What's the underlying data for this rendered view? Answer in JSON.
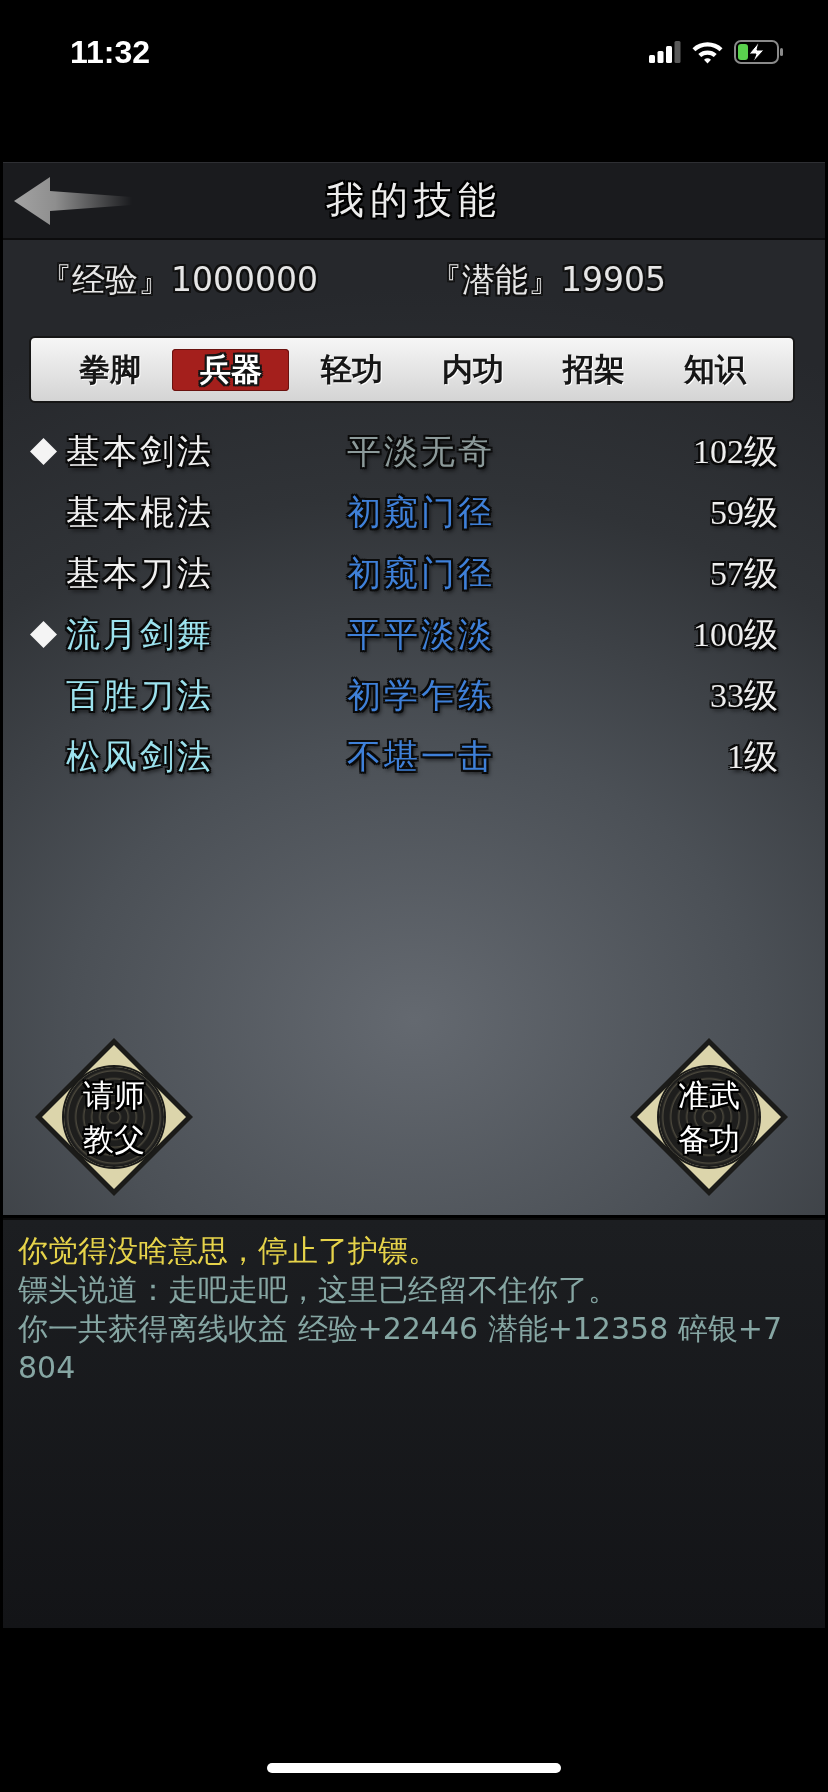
{
  "status_bar": {
    "time": "11:32"
  },
  "header": {
    "title": "我的技能"
  },
  "stats": [
    "『经验』1000000",
    "『潜能』19905"
  ],
  "tabs": [
    {
      "label": "拳脚",
      "selected": false
    },
    {
      "label": "兵器",
      "selected": true
    },
    {
      "label": "轻功",
      "selected": false
    },
    {
      "label": "内功",
      "selected": false
    },
    {
      "label": "招架",
      "selected": false
    },
    {
      "label": "知识",
      "selected": false
    }
  ],
  "skills": [
    {
      "equipped": true,
      "name": {
        "text": "基本剑法",
        "color": "#f0f0f0"
      },
      "tier": {
        "text": "平淡无奇",
        "color": "#8c9a9a"
      },
      "level": "102级"
    },
    {
      "equipped": false,
      "name": {
        "text": "基本棍法",
        "color": "#f0f0f0"
      },
      "tier": {
        "text": "初窥门径",
        "color": "#3f80d8"
      },
      "level": "59级"
    },
    {
      "equipped": false,
      "name": {
        "text": "基本刀法",
        "color": "#f0f0f0"
      },
      "tier": {
        "text": "初窥门径",
        "color": "#3f80d8"
      },
      "level": "57级"
    },
    {
      "equipped": true,
      "name": {
        "text": "流月剑舞",
        "color": "#9ce2ee"
      },
      "tier": {
        "text": "平平淡淡",
        "color": "#3f80d8"
      },
      "level": "100级"
    },
    {
      "equipped": false,
      "name": {
        "text": "百胜刀法",
        "color": "#9ce2ee"
      },
      "tier": {
        "text": "初学乍练",
        "color": "#3f80d8"
      },
      "level": "33级"
    },
    {
      "equipped": false,
      "name": {
        "text": "松风剑法",
        "color": "#9ce2ee"
      },
      "tier": {
        "text": "不堪一击",
        "color": "#3f80d8"
      },
      "level": "1级"
    }
  ],
  "buttons": [
    {
      "label": "请师教父"
    },
    {
      "label": "准武备功"
    }
  ],
  "log": [
    {
      "text": "你觉得没啥意思，停止了护镖。",
      "color": "#e6d34a"
    },
    {
      "text": "镖头说道：走吧走吧，这里已经留不住你了。",
      "color": "#86a6a3"
    },
    {
      "text": "你一共获得离线收益 经验+22446 潜能+12358 碎银+7804",
      "color": "#86a6a3"
    }
  ]
}
